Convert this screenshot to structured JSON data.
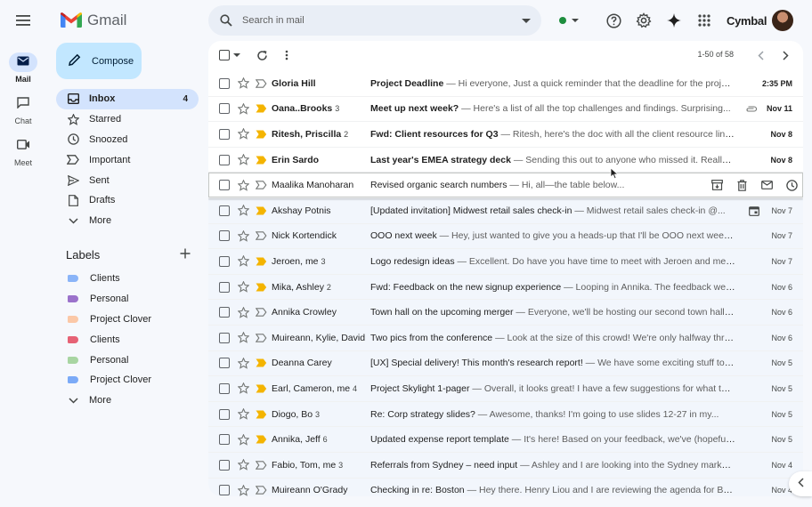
{
  "app": {
    "logo_text": "Gmail",
    "brand": "Cymbal"
  },
  "rail": [
    {
      "label": "Mail",
      "icon": "mail-icon",
      "active": true
    },
    {
      "label": "Chat",
      "icon": "chat-icon",
      "active": false
    },
    {
      "label": "Meet",
      "icon": "meet-icon",
      "active": false
    }
  ],
  "search": {
    "placeholder": "Search in mail"
  },
  "compose": {
    "label": "Compose"
  },
  "nav": [
    {
      "label": "Inbox",
      "count": "4",
      "icon": "inbox-icon",
      "active": true
    },
    {
      "label": "Starred",
      "count": "",
      "icon": "star-icon"
    },
    {
      "label": "Snoozed",
      "count": "",
      "icon": "clock-icon"
    },
    {
      "label": "Important",
      "count": "",
      "icon": "important-icon"
    },
    {
      "label": "Sent",
      "count": "",
      "icon": "send-icon"
    },
    {
      "label": "Drafts",
      "count": "",
      "icon": "draft-icon"
    },
    {
      "label": "More",
      "count": "",
      "icon": "chevron-down-icon"
    }
  ],
  "labels": {
    "title": "Labels",
    "items": [
      {
        "label": "Clients",
        "color": "#8ab4f8"
      },
      {
        "label": "Personal",
        "color": "#9b72cb"
      },
      {
        "label": "Project Clover",
        "color": "#fbc8a7"
      },
      {
        "label": "Clients",
        "color": "#e66275"
      },
      {
        "label": "Personal",
        "color": "#a8d5a2"
      },
      {
        "label": "Project Clover",
        "color": "#7baaf7"
      }
    ],
    "more": "More"
  },
  "toolbar": {
    "pager": "1-50 of 58"
  },
  "emails": [
    {
      "sender": "Gloria Hill",
      "count": "",
      "subject": "Project Deadline",
      "snippet": " — Hi everyone, Just a quick reminder that the deadline for the project is...",
      "date": "2:35 PM",
      "unread": true,
      "important": false,
      "extra": ""
    },
    {
      "sender": "Oana..Brooks",
      "count": "3",
      "subject": "Meet up next week?",
      "snippet": " — Here's a list of all the top challenges and findings. Surprising...",
      "date": "Nov 11",
      "unread": true,
      "important": true,
      "extra": "attach"
    },
    {
      "sender": "Ritesh, Priscilla",
      "count": "2",
      "subject": "Fwd: Client resources for Q3",
      "snippet": " — Ritesh, here's the doc with all the client resource links for yo...",
      "date": "Nov 8",
      "unread": true,
      "important": true,
      "extra": ""
    },
    {
      "sender": "Erin Sardo",
      "count": "",
      "subject": "Last year's EMEA strategy deck",
      "snippet": " — Sending this out to anyone who missed it. Really great...",
      "date": "Nov 8",
      "unread": true,
      "important": true,
      "extra": ""
    },
    {
      "sender": "Maalika Manoharan",
      "count": "",
      "subject": "Revised organic search numbers",
      "snippet": " — Hi, all—the table below...",
      "date": "",
      "unread": false,
      "important": false,
      "extra": "hover"
    },
    {
      "sender": "Akshay Potnis",
      "count": "",
      "subject": "[Updated invitation] Midwest retail sales check-in",
      "snippet": " — Midwest retail sales check-in @...",
      "date": "Nov 7",
      "unread": false,
      "important": true,
      "extra": "cal"
    },
    {
      "sender": "Nick Kortendick",
      "count": "",
      "subject": "OOO next week",
      "snippet": " — Hey, just wanted to give you a heads-up that I'll be OOO next week. If you...",
      "date": "Nov 7",
      "unread": false,
      "important": false,
      "extra": ""
    },
    {
      "sender": "Jeroen, me",
      "count": "3",
      "subject": "Logo redesign ideas",
      "snippet": " — Excellent. Do have you have time to meet with Jeroen and me this...",
      "date": "Nov 7",
      "unread": false,
      "important": true,
      "extra": ""
    },
    {
      "sender": "Mika, Ashley",
      "count": "2",
      "subject": "Fwd: Feedback on the new signup experience",
      "snippet": " — Looping in Annika. The feedback we've...",
      "date": "Nov 6",
      "unread": false,
      "important": true,
      "extra": ""
    },
    {
      "sender": "Annika Crowley",
      "count": "",
      "subject": "Town hall on the upcoming merger",
      "snippet": " — Everyone, we'll be hosting our second town hall to talk...",
      "date": "Nov 6",
      "unread": false,
      "important": false,
      "extra": ""
    },
    {
      "sender": "Muireann, Kylie, David",
      "count": "",
      "subject": "Two pics from the conference",
      "snippet": " — Look at the size of this crowd! We're only halfway through...",
      "date": "Nov 6",
      "unread": false,
      "important": false,
      "extra": ""
    },
    {
      "sender": "Deanna Carey",
      "count": "",
      "subject": "[UX] Special delivery! This month's research report!",
      "snippet": " — We have some exciting stuff to show...",
      "date": "Nov 5",
      "unread": false,
      "important": true,
      "extra": ""
    },
    {
      "sender": "Earl, Cameron, me",
      "count": "4",
      "subject": "Project Skylight 1-pager",
      "snippet": " — Overall, it looks great! I have a few suggestions for what the end...",
      "date": "Nov 5",
      "unread": false,
      "important": true,
      "extra": ""
    },
    {
      "sender": "Diogo, Bo",
      "count": "3",
      "subject": "Re: Corp strategy slides?",
      "snippet": " — Awesome, thanks! I'm going to use slides 12-27 in my...",
      "date": "Nov 5",
      "unread": false,
      "important": true,
      "extra": ""
    },
    {
      "sender": "Annika, Jeff",
      "count": "6",
      "subject": "Updated expense report template",
      "snippet": " — It's here! Based on your feedback, we've (hopefully)...",
      "date": "Nov 5",
      "unread": false,
      "important": true,
      "extra": ""
    },
    {
      "sender": "Fabio, Tom, me",
      "count": "3",
      "subject": "Referrals from Sydney – need input",
      "snippet": " — Ashley and I are looking into the Sydney market, and...",
      "date": "Nov 4",
      "unread": false,
      "important": false,
      "extra": ""
    },
    {
      "sender": "Muireann O'Grady",
      "count": "",
      "subject": "Checking in re: Boston",
      "snippet": " — Hey there. Henry Liou and I are reviewing the agenda for Boston...",
      "date": "Nov 4",
      "unread": false,
      "important": false,
      "extra": ""
    }
  ],
  "colors": {
    "accent": "#0b57d0",
    "important": "#f4b400",
    "compose_bg": "#c2e7ff",
    "selected_nav": "#d3e3fd"
  }
}
